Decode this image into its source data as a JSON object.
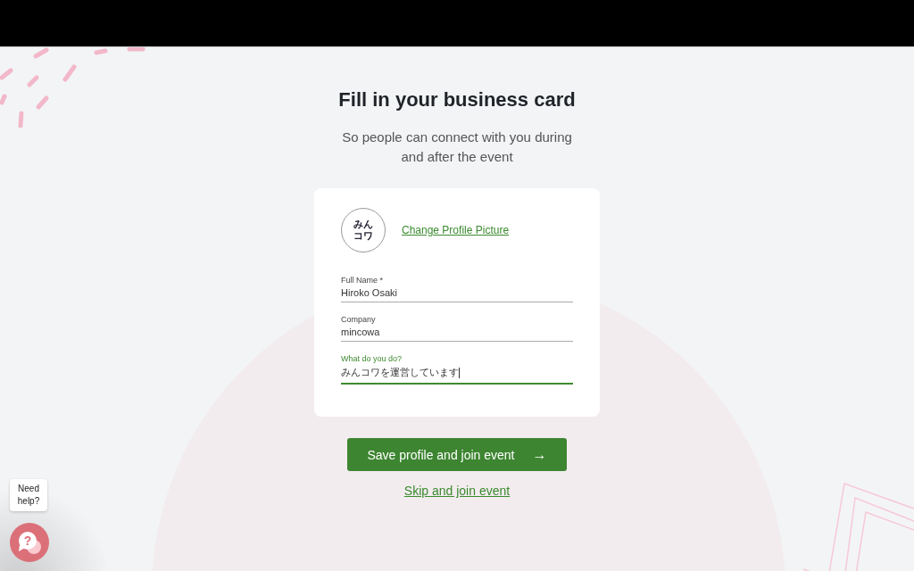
{
  "heading": "Fill in your business card",
  "subtitle": "So people can connect with you during and after the event",
  "profile": {
    "logo_text": [
      "みん",
      "コワ"
    ],
    "change_link": "Change Profile Picture"
  },
  "fields": [
    {
      "label": "Full Name *",
      "value": "Hiroko Osaki",
      "focused": false
    },
    {
      "label": "Company",
      "value": "mincowa",
      "focused": false
    },
    {
      "label": "What do you do?",
      "value": "みんコワを運営しています",
      "focused": true
    }
  ],
  "primary_button": {
    "label": "Save profile and join event",
    "arrow": "→"
  },
  "skip_link": "Skip and join event",
  "help": {
    "tooltip": "Need help?",
    "icon_glyph": "?"
  }
}
